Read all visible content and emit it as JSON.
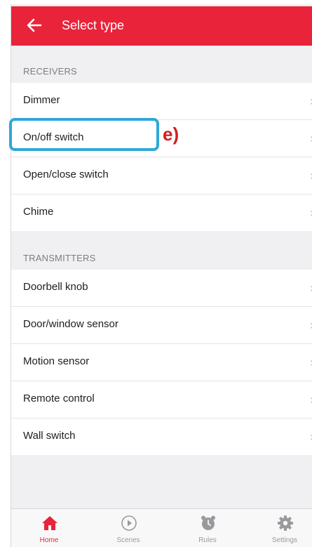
{
  "header": {
    "back_icon": "arrow-left-icon",
    "title": "Select type",
    "color": "#e8233a"
  },
  "receivers": {
    "heading": "RECEIVERS",
    "items": [
      {
        "label": "Dimmer"
      },
      {
        "label": "On/off switch"
      },
      {
        "label": "Open/close switch"
      },
      {
        "label": "Chime"
      }
    ]
  },
  "transmitters": {
    "heading": "TRANSMITTERS",
    "items": [
      {
        "label": "Doorbell knob"
      },
      {
        "label": "Door/window sensor"
      },
      {
        "label": "Motion sensor"
      },
      {
        "label": "Remote control"
      },
      {
        "label": "Wall switch"
      }
    ]
  },
  "annotation": {
    "label": "e)",
    "highlight_color": "#2fa7d8",
    "text_color": "#d11f1f"
  },
  "tabbar": {
    "tabs": [
      {
        "label": "Home",
        "icon": "home-icon",
        "active": true
      },
      {
        "label": "Scenes",
        "icon": "play-circle-icon",
        "active": false
      },
      {
        "label": "Rules",
        "icon": "alarm-clock-icon",
        "active": false
      },
      {
        "label": "Settings",
        "icon": "gear-icon",
        "active": false
      }
    ]
  }
}
